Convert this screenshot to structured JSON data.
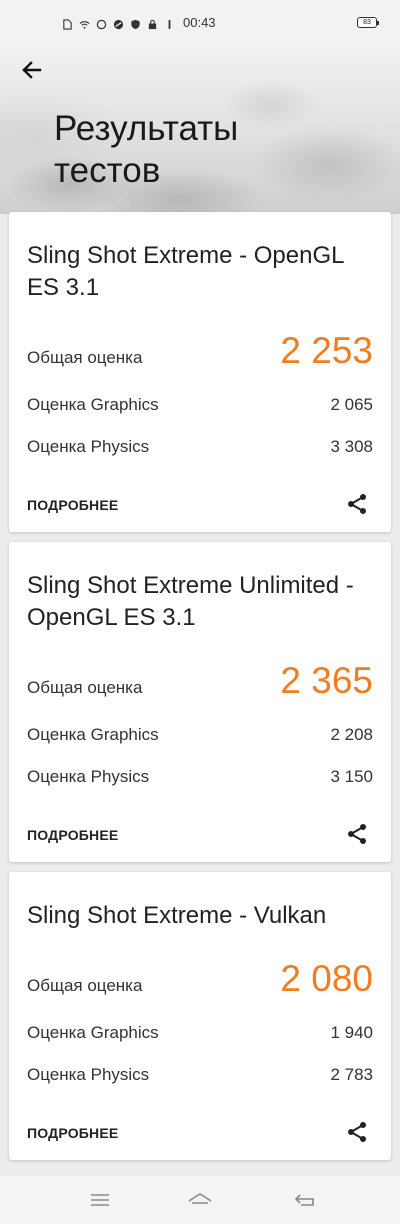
{
  "status_bar": {
    "time": "00:43",
    "battery": "83",
    "icons": [
      "doc-icon",
      "wifi-icon",
      "circle-icon",
      "vpn-icon",
      "shield-icon",
      "lock-icon",
      "pin-icon"
    ]
  },
  "header": {
    "title_line1": "Результаты",
    "title_line2": "тестов"
  },
  "labels": {
    "overall": "Общая оценка",
    "graphics": "Оценка Graphics",
    "physics": "Оценка Physics",
    "more": "ПОДРОБНЕЕ"
  },
  "results": [
    {
      "title": "Sling Shot Extreme - OpenGL ES 3.1",
      "overall": "2 253",
      "graphics": "2 065",
      "physics": "3 308"
    },
    {
      "title": "Sling Shot Extreme Unlimited - OpenGL ES 3.1",
      "overall": "2 365",
      "graphics": "2 208",
      "physics": "3 150"
    },
    {
      "title": "Sling Shot Extreme - Vulkan",
      "overall": "2 080",
      "graphics": "1 940",
      "physics": "2 783"
    }
  ],
  "colors": {
    "accent": "#ef7d22",
    "card_background": "#ffffff",
    "page_background": "#ececec"
  }
}
